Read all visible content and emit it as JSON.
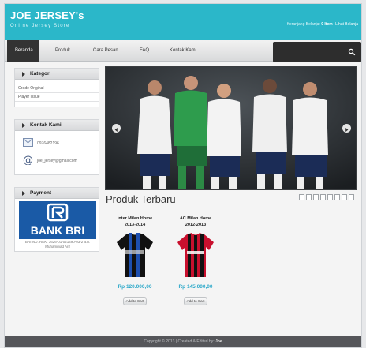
{
  "header": {
    "title": "JOE JERSEY's",
    "tagline": "Online Jersey Store",
    "cart_prefix": "Keranjang Belanja:",
    "cart_count": "0 Item",
    "cart_link": "Lihat Belanja"
  },
  "nav": {
    "items": [
      "Beranda",
      "Produk",
      "Cara Pesan",
      "FAQ",
      "Kontak Kami"
    ],
    "search_placeholder": ""
  },
  "sidebar": {
    "kategori_title": "Kategori",
    "kategori_items": [
      "Grade Original",
      "Player Issue"
    ],
    "kontak_title": "Kontak Kami",
    "phone": "0976482196",
    "email": "joe_jersey@gmail.com",
    "payment_title": "Payment",
    "bank_logo_text": "BANK BRI",
    "bank_account": "BRI NO. REK: 3626-01-021490-03-2 a.n. Muhammad Arif"
  },
  "main": {
    "produk_title": "Produk Terbaru",
    "products": [
      {
        "name_line1": "Inter Milan Home",
        "name_line2": "2013-2014",
        "price": "Rp 120.000,00",
        "button": "Add to Cart"
      },
      {
        "name_line1": "AC Milan Home",
        "name_line2": "2012-2013",
        "price": "Rp 145.000,00",
        "button": "Add to Cart"
      }
    ]
  },
  "footer": {
    "text": "Copyright © 2013 | Created & Edited by:",
    "author": "Joe"
  },
  "colors": {
    "brand": "#2bb7c9",
    "price": "#2ba8c9",
    "bri_blue": "#1a5aa6"
  }
}
